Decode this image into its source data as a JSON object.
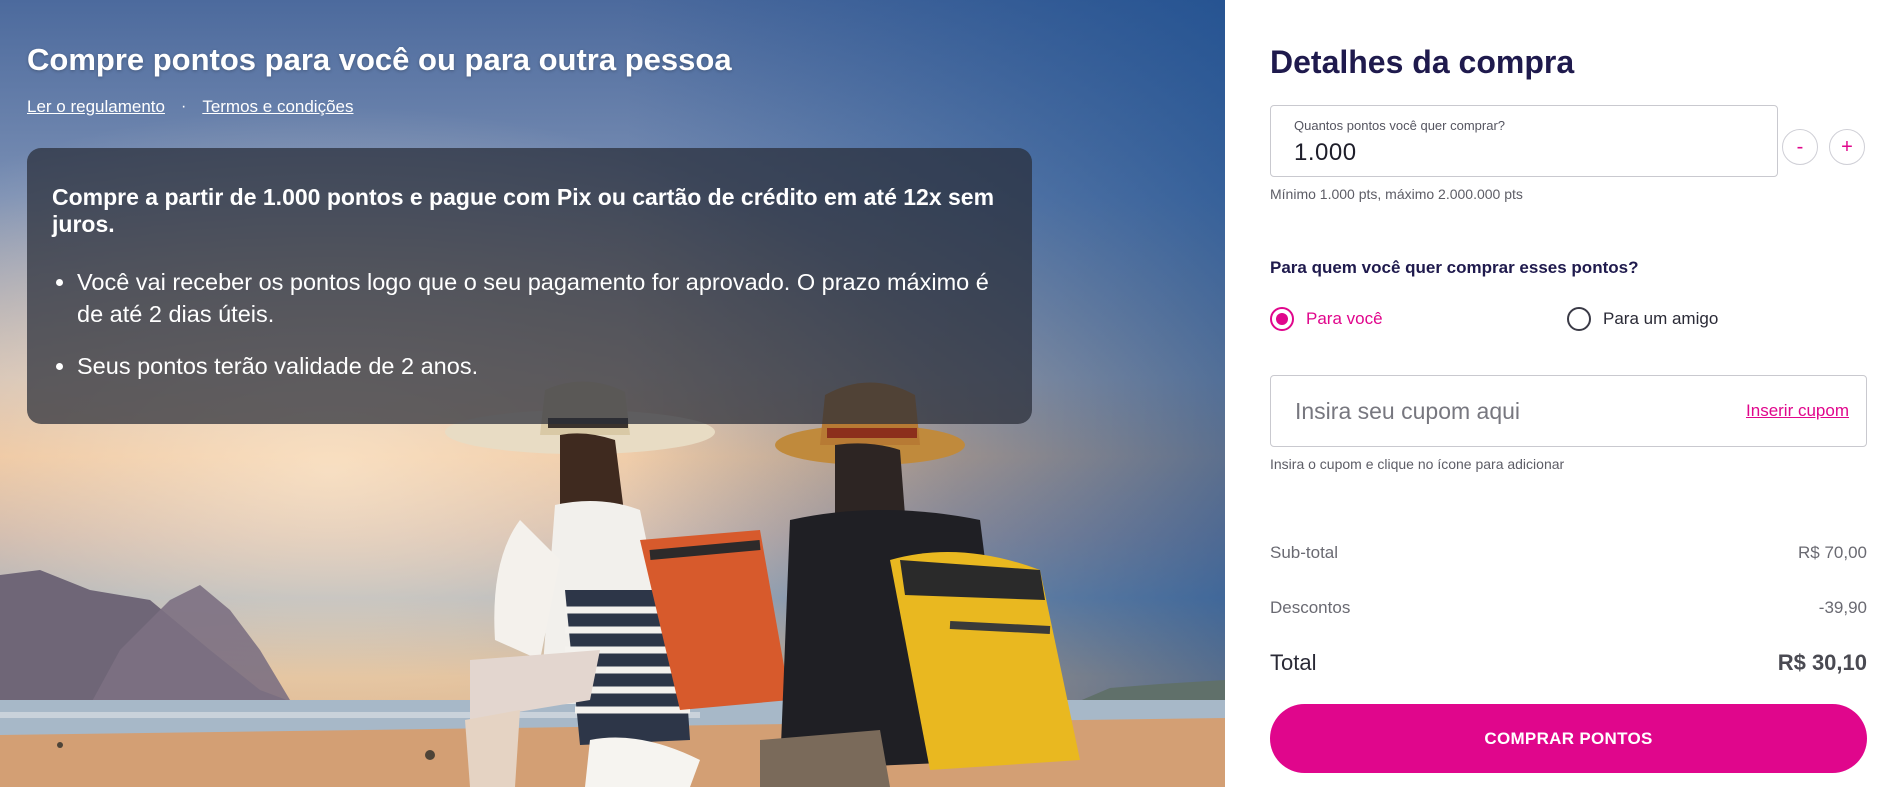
{
  "hero": {
    "title": "Compre pontos para você ou para outra pessoa",
    "links": {
      "regulation": "Ler o regulamento",
      "separator": "·",
      "terms": "Termos e condições"
    },
    "info": {
      "headline": "Compre a partir de 1.000 pontos e pague com Pix ou cartão de crédito em até 12x sem juros.",
      "bullets": [
        "Você vai receber os pontos logo que o seu pagamento for aprovado. O prazo máximo é de até 2 dias úteis.",
        "Seus pontos terão validade de 2 anos."
      ]
    },
    "image": "couple-on-beach-photo"
  },
  "purchase": {
    "title": "Detalhes da compra",
    "quantity": {
      "label": "Quantos pontos você quer comprar?",
      "value": "1.000",
      "minus": "-",
      "plus": "+",
      "hint": "Mínimo 1.000 pts, máximo 2.000.000 pts"
    },
    "recipient": {
      "question": "Para quem você quer comprar esses pontos?",
      "options": [
        {
          "label": "Para você",
          "selected": true
        },
        {
          "label": "Para um amigo",
          "selected": false
        }
      ]
    },
    "coupon": {
      "placeholder": "Insira seu cupom aqui",
      "action": "Inserir cupom",
      "hint": "Insira o cupom e clique no ícone para adicionar"
    },
    "summary": {
      "subtotal_label": "Sub-total",
      "subtotal_value": "R$ 70,00",
      "discount_label": "Descontos",
      "discount_value": "-39,90",
      "total_label": "Total",
      "total_value": "R$ 30,10"
    },
    "cta": "COMPRAR PONTOS"
  },
  "colors": {
    "accent": "#e0068c",
    "heading": "#1f1a4d"
  }
}
